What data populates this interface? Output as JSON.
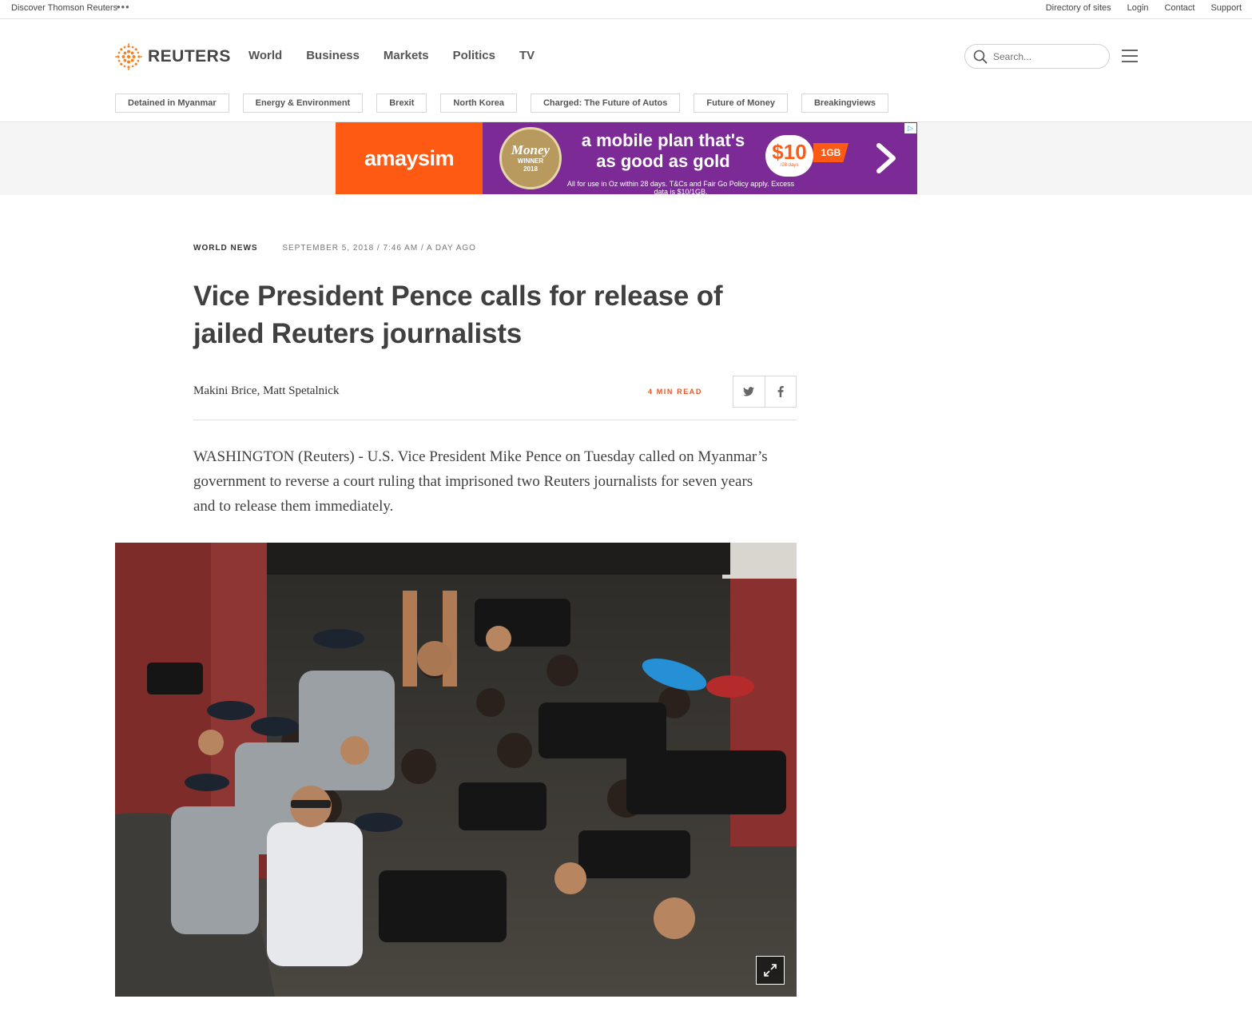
{
  "utility": {
    "discover": "Discover Thomson Reuters",
    "dots": "•••",
    "links": [
      "Directory of sites",
      "Login",
      "Contact",
      "Support"
    ]
  },
  "header": {
    "logo_text": "REUTERS",
    "nav": [
      "World",
      "Business",
      "Markets",
      "Politics",
      "TV"
    ],
    "search_placeholder": "Search..."
  },
  "tags": [
    "Detained in Myanmar",
    "Energy & Environment",
    "Brexit",
    "North Korea",
    "Charged: The Future of Autos",
    "Future of Money",
    "Breakingviews"
  ],
  "ad": {
    "brand": "amaysim",
    "badge_title": "Money",
    "badge_sub1": "WINNER",
    "badge_sub2": "2018",
    "headline_line1": "a mobile plan that's",
    "headline_line2": "as good as gold",
    "price": "$10",
    "price_period": "/28 days",
    "data_amount": "1GB",
    "fine_print": "All for use in Oz within 28 days. T&Cs and Fair Go Policy apply. Excess data is $10/1GB.",
    "colors": {
      "brand": "#ff5a14",
      "background": "#7b2a96"
    }
  },
  "article": {
    "section": "WORLD NEWS",
    "dateline": "SEPTEMBER 5, 2018 / 7:46 AM / A DAY AGO",
    "title": "Vice President Pence calls for release of jailed Reuters journalists",
    "authors": "Makini Brice, Matt Spetalnick",
    "read_time": "4 MIN READ",
    "lede": "WASHINGTON (Reuters) - U.S. Vice President Mike Pence on Tuesday called on Myanmar’s government to reverse a court ruling that imprisoned two Reuters journalists for seven years and to release them immediately."
  },
  "share": {
    "icons": [
      "twitter-icon",
      "facebook-icon"
    ]
  },
  "theme": {
    "accent": "#e0582a",
    "logo_orange": "#f58220"
  }
}
